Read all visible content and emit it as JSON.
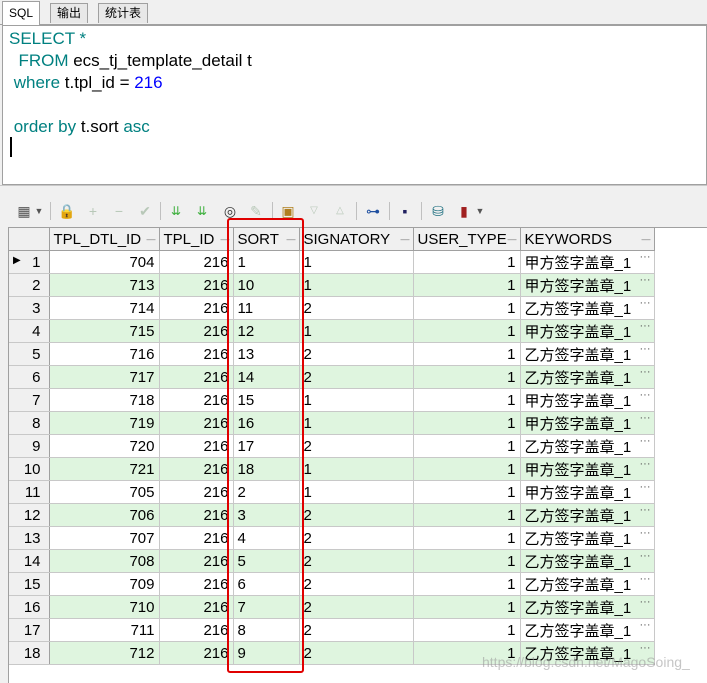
{
  "tabs": [
    "SQL",
    "输出",
    "统计表"
  ],
  "editor": {
    "lines": [
      [
        {
          "t": "SELECT *",
          "k": "kw"
        }
      ],
      [
        {
          "t": "  FROM",
          "k": "kw"
        },
        {
          "t": " ecs_tj_template_detail t",
          "k": "txt"
        }
      ],
      [
        {
          "t": " where",
          "k": "kw"
        },
        {
          "t": " t.tpl_id = ",
          "k": "txt"
        },
        {
          "t": "216",
          "k": "num"
        }
      ],
      [],
      [
        {
          "t": " order by",
          "k": "kw"
        },
        {
          "t": " t.sort ",
          "k": "txt"
        },
        {
          "t": "asc",
          "k": "kw"
        }
      ]
    ]
  },
  "grid": {
    "columns": [
      "TPL_DTL_ID",
      "TPL_ID",
      "SORT",
      "SIGNATORY",
      "USER_TYPE",
      "KEYWORDS"
    ],
    "rows": [
      [
        "1",
        "704",
        "216",
        "1",
        "1",
        "1",
        "甲方签字盖章_1"
      ],
      [
        "2",
        "713",
        "216",
        "10",
        "1",
        "1",
        "甲方签字盖章_1"
      ],
      [
        "3",
        "714",
        "216",
        "11",
        "2",
        "1",
        "乙方签字盖章_1"
      ],
      [
        "4",
        "715",
        "216",
        "12",
        "1",
        "1",
        "甲方签字盖章_1"
      ],
      [
        "5",
        "716",
        "216",
        "13",
        "2",
        "1",
        "乙方签字盖章_1"
      ],
      [
        "6",
        "717",
        "216",
        "14",
        "2",
        "1",
        "乙方签字盖章_1"
      ],
      [
        "7",
        "718",
        "216",
        "15",
        "1",
        "1",
        "甲方签字盖章_1"
      ],
      [
        "8",
        "719",
        "216",
        "16",
        "1",
        "1",
        "甲方签字盖章_1"
      ],
      [
        "9",
        "720",
        "216",
        "17",
        "2",
        "1",
        "乙方签字盖章_1"
      ],
      [
        "10",
        "721",
        "216",
        "18",
        "1",
        "1",
        "甲方签字盖章_1"
      ],
      [
        "11",
        "705",
        "216",
        "2",
        "1",
        "1",
        "甲方签字盖章_1"
      ],
      [
        "12",
        "706",
        "216",
        "3",
        "2",
        "1",
        "乙方签字盖章_1"
      ],
      [
        "13",
        "707",
        "216",
        "4",
        "2",
        "1",
        "乙方签字盖章_1"
      ],
      [
        "14",
        "708",
        "216",
        "5",
        "2",
        "1",
        "乙方签字盖章_1"
      ],
      [
        "15",
        "709",
        "216",
        "6",
        "2",
        "1",
        "乙方签字盖章_1"
      ],
      [
        "16",
        "710",
        "216",
        "7",
        "2",
        "1",
        "乙方签字盖章_1"
      ],
      [
        "17",
        "711",
        "216",
        "8",
        "2",
        "1",
        "乙方签字盖章_1"
      ],
      [
        "18",
        "712",
        "216",
        "9",
        "2",
        "1",
        "乙方签字盖章_1"
      ]
    ]
  },
  "colors": {
    "keyword": "#008080",
    "number": "#0000ff",
    "row_alt": "#dff5df",
    "highlight": "#e00000"
  },
  "watermark": "https://blog.csdn.net/MagoSoing_"
}
